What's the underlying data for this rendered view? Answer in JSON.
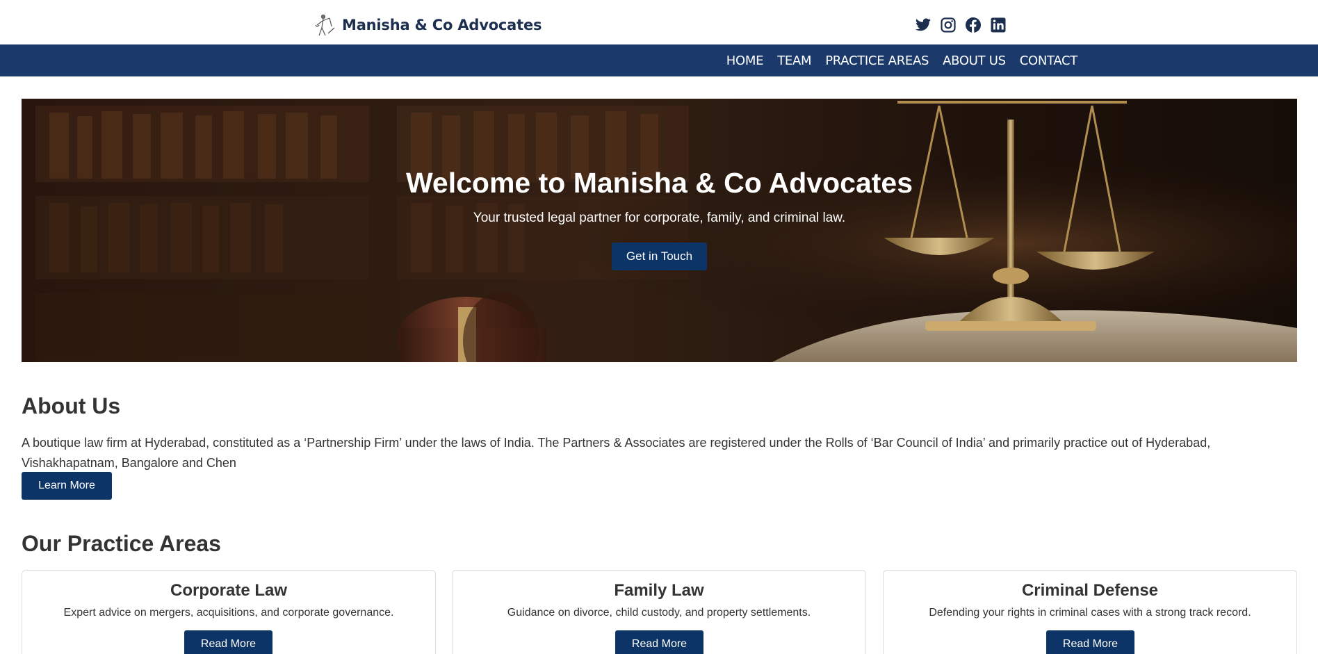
{
  "header": {
    "brand_name": "Manisha & Co Advocates",
    "social_icons": [
      "twitter-icon",
      "instagram-icon",
      "facebook-icon",
      "linkedin-icon"
    ]
  },
  "nav": {
    "items": [
      "HOME",
      "TEAM",
      "PRACTICE AREAS",
      "ABOUT US",
      "CONTACT"
    ]
  },
  "hero": {
    "title": "Welcome to Manisha & Co Advocates",
    "subtitle": "Your trusted legal partner for corporate, family, and criminal law.",
    "cta_label": "Get in Touch"
  },
  "about": {
    "title": "About Us",
    "text": "A boutique law firm at Hyderabad, constituted as a ‘Partnership Firm’ under the laws of India. The Partners & Associates are registered under the Rolls of ‘Bar Council of India’ and primarily practice out of Hyderabad, Vishakhapatnam, Bangalore and Chen",
    "button_label": "Learn More"
  },
  "practice": {
    "title": "Our Practice Areas",
    "cards": [
      {
        "title": "Corporate Law",
        "text": "Expert advice on mergers, acquisitions, and corporate governance.",
        "button_label": "Read More"
      },
      {
        "title": "Family Law",
        "text": "Guidance on divorce, child custody, and property settlements.",
        "button_label": "Read More"
      },
      {
        "title": "Criminal Defense",
        "text": "Defending your rights in criminal cases with a strong track record.",
        "button_label": "Read More"
      }
    ]
  },
  "colors": {
    "brand_navy": "#1b3a6b",
    "button_navy": "#0d3466",
    "text": "#333333"
  }
}
